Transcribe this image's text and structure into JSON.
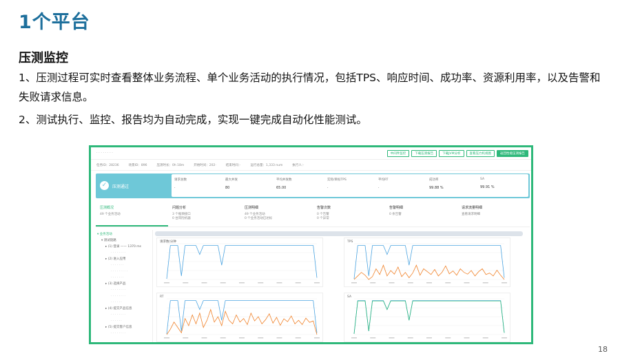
{
  "slide": {
    "title": "1个平台",
    "section_heading": "压测监控",
    "paragraphs": [
      "1、压测过程可实时查看整体业务流程、单个业务活动的执行情况，包括TPS、响应时间、成功率、资源利用率，以及告警和失败请求信息。",
      "2、测试执行、监控、报告均为自动完成，实现一键完成自动化性能测试。"
    ],
    "page_number": "18"
  },
  "screenshot": {
    "topbar": {
      "breadcrumb": "· · · · · · · ·",
      "buttons": [
        {
          "label": "中间件监控",
          "primary": false
        },
        {
          "label": "下载压测报告",
          "primary": false
        },
        {
          "label": "下载JVM分析",
          "primary": false
        },
        {
          "label": "查看压力机视图",
          "primary": false
        },
        {
          "label": "返回性能压测报告",
          "primary": true
        }
      ]
    },
    "infobar": [
      "任务ID：28236",
      "场景ID：896",
      "压测时长：0h 18m",
      "开始时间：202·",
      "结束时间：·",
      "运行总量：1,333 num",
      "执行人：·"
    ],
    "status": {
      "label": "压测通过",
      "metrics": [
        {
          "label": "请求总数",
          "value": "·"
        },
        {
          "label": "最大并发",
          "value": "80"
        },
        {
          "label": "平均并发数",
          "value": "65.00"
        },
        {
          "label": "实际/目标TPS",
          "value": "·"
        },
        {
          "label": "平均RT",
          "value": "·"
        },
        {
          "label": "成功率",
          "value": "99.88 %"
        },
        {
          "label": "SA",
          "value": "99.91 %"
        }
      ]
    },
    "tabs": [
      {
        "title": "压测概况",
        "lines": [
          "49 个业务活动"
        ],
        "active": true
      },
      {
        "title": "问题分析",
        "lines": [
          "3 个瓶颈接口",
          "0 台风险机器"
        ],
        "active": false
      },
      {
        "title": "压测明细",
        "lines": [
          "49 个业务活动",
          "0 个业务活动已达标"
        ],
        "active": false
      },
      {
        "title": "告警次数",
        "lines": [
          "0 个告警",
          "0 个异常"
        ],
        "active": false
      },
      {
        "title": "告警明细",
        "lines": [
          "0 条告警"
        ],
        "active": false
      },
      {
        "title": "请求流量明细",
        "lines": [
          "查看请求明细"
        ],
        "active": false
      }
    ],
    "tree": [
      {
        "label": "▾ 业务活动",
        "level": 0,
        "selected": true
      },
      {
        "label": "▾ 测试链路",
        "level": 1
      },
      {
        "label": "▸ (1) 登录 —— 1370 ms",
        "level": 2
      },
      {
        "label": "· · · · · · · ·",
        "level": 3
      },
      {
        "label": "▸ (2) 进入应用",
        "level": 2
      },
      {
        "label": "· · · · · · ·",
        "level": 3
      },
      {
        "label": "· · · · · · · · ·",
        "level": 3
      },
      {
        "label": "· · · · · · ·",
        "level": 3
      },
      {
        "label": "▸ (3) 选择产品",
        "level": 2
      },
      {
        "label": "· · · · · · · ·",
        "level": 3
      },
      {
        "label": "· · · · · · · ·",
        "level": 3
      },
      {
        "label": "· · · · · ·",
        "level": 3
      },
      {
        "label": "▸ (4) 提交产品信息",
        "level": 2
      },
      {
        "label": "· · · · · · · ·",
        "level": 3
      },
      {
        "label": "· · · · · ·",
        "level": 3
      },
      {
        "label": "▸ (5) 提交客户信息",
        "level": 2
      },
      {
        "label": "· · · · · · · ·",
        "level": 3
      }
    ],
    "colors": {
      "accent": "#2eb87a",
      "status_bg": "#6ec8d8",
      "series_blue": "#4aa3e0",
      "series_orange": "#f0822a"
    }
  },
  "chart_data": [
    {
      "type": "line",
      "title": "请求数/分钟",
      "series": [
        {
          "color": "#4aa3e0",
          "values": [
            2,
            95,
            95,
            95,
            10,
            95,
            95,
            95,
            95,
            70,
            95,
            95,
            95,
            95,
            95,
            40,
            95,
            95,
            95,
            95,
            95,
            95,
            95,
            95,
            95,
            95,
            95,
            95,
            95,
            95,
            95,
            95,
            95,
            95,
            95,
            95,
            95,
            95,
            95,
            95,
            95,
            5
          ]
        }
      ]
    },
    {
      "type": "line",
      "title": "TPS",
      "series": [
        {
          "color": "#4aa3e0",
          "values": [
            2,
            95,
            95,
            95,
            10,
            95,
            95,
            95,
            95,
            70,
            95,
            95,
            95,
            95,
            95,
            40,
            95,
            95,
            95,
            95,
            95,
            95,
            95,
            95,
            95,
            95,
            95,
            95,
            95,
            95,
            95,
            95,
            95,
            95,
            95,
            95,
            95,
            95,
            95,
            95,
            95,
            5
          ]
        },
        {
          "color": "#f0822a",
          "values": [
            0,
            10,
            20,
            12,
            0,
            8,
            30,
            14,
            40,
            10,
            25,
            15,
            35,
            8,
            20,
            5,
            18,
            40,
            12,
            30,
            22,
            14,
            28,
            10,
            20,
            38,
            16,
            24,
            12,
            30,
            20,
            15,
            25,
            10,
            22,
            30,
            14,
            18,
            10,
            26,
            12,
            0
          ]
        }
      ]
    },
    {
      "type": "line",
      "title": "RT",
      "series": [
        {
          "color": "#4aa3e0",
          "values": [
            2,
            95,
            95,
            95,
            10,
            95,
            95,
            95,
            95,
            70,
            95,
            95,
            95,
            95,
            95,
            40,
            95,
            95,
            95,
            95,
            95,
            95,
            95,
            95,
            95,
            95,
            95,
            95,
            95,
            95,
            95,
            95,
            95,
            95,
            95,
            95,
            95,
            95,
            95,
            95,
            95,
            5
          ]
        },
        {
          "color": "#f0822a",
          "values": [
            0,
            15,
            35,
            20,
            5,
            45,
            25,
            55,
            30,
            60,
            20,
            40,
            70,
            35,
            50,
            25,
            65,
            40,
            30,
            55,
            35,
            45,
            28,
            60,
            38,
            50,
            30,
            42,
            58,
            32,
            48,
            26,
            44,
            36,
            52,
            30,
            40,
            28,
            46,
            34,
            38,
            0
          ]
        }
      ]
    },
    {
      "type": "line",
      "title": "SA",
      "series": [
        {
          "color": "#4aa3e0",
          "values": [
            2,
            95,
            95,
            95,
            10,
            95,
            95,
            95,
            95,
            70,
            95,
            95,
            95,
            95,
            95,
            40,
            95,
            95,
            95,
            95,
            95,
            95,
            95,
            95,
            95,
            95,
            95,
            95,
            95,
            95,
            95,
            95,
            95,
            95,
            95,
            95,
            95,
            95,
            95,
            95,
            95,
            5
          ]
        },
        {
          "color": "#2eb87a",
          "values": [
            2,
            94,
            94,
            94,
            10,
            94,
            94,
            94,
            94,
            70,
            94,
            94,
            94,
            94,
            94,
            40,
            94,
            94,
            94,
            94,
            94,
            94,
            94,
            94,
            94,
            94,
            94,
            94,
            94,
            94,
            94,
            94,
            94,
            94,
            94,
            94,
            94,
            94,
            94,
            94,
            94,
            5
          ]
        }
      ]
    }
  ]
}
